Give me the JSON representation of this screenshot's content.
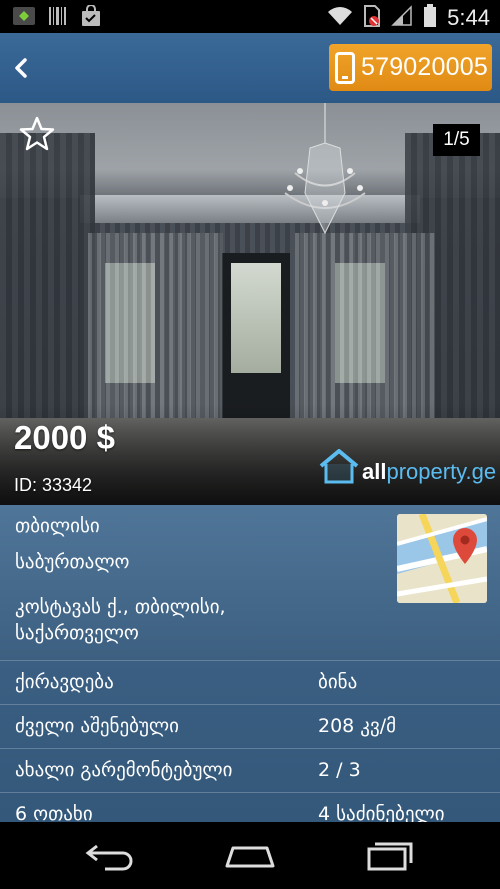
{
  "status_bar": {
    "time": "5:44",
    "icons": [
      "app-icon",
      "barcode-icon",
      "shopping-bag-icon",
      "wifi-icon",
      "no-sim-icon",
      "signal-icon",
      "battery-icon"
    ]
  },
  "action_bar": {
    "back_icon": "chevron-left-icon",
    "phone_number": "579020005",
    "phone_icon": "mobile-phone-icon",
    "accent_color": "#e8911a"
  },
  "listing": {
    "photo_counter": "1/5",
    "price": "2000 $",
    "id_text": "ID: 33342",
    "logo": {
      "prefix": "all",
      "suffix": "property.ge"
    }
  },
  "location": {
    "city": "თბილისი",
    "district": "საბურთალო",
    "address_line1": "კოსტავას ქ., თბილისი,",
    "address_line2": "საქართველო",
    "map_icon": "map-pin-icon"
  },
  "details": [
    {
      "label": "ქირავდება",
      "value": "ბინა"
    },
    {
      "label": "ძველი აშენებული",
      "value": "208 კვ/მ"
    },
    {
      "label": "ახალი გარემონტებული",
      "value": "2 / 3"
    },
    {
      "label": "6 ოთახი",
      "value": "4 საძინებელი"
    }
  ],
  "nav_bar": {
    "icons": [
      "back-arrow-icon",
      "home-icon",
      "recent-apps-icon"
    ]
  }
}
